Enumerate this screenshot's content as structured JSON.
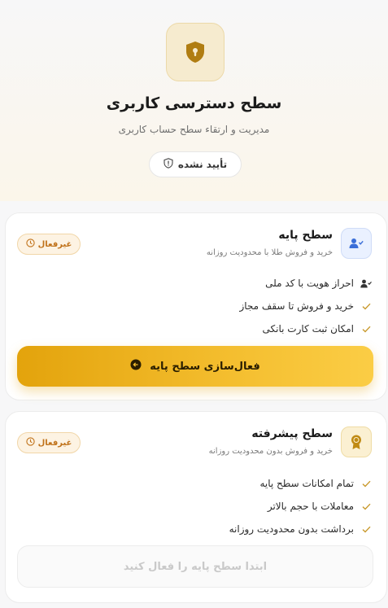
{
  "hero": {
    "icon": "shield-lock-icon",
    "title": "سطح دسترسی کاربری",
    "subtitle": "مدیریت و ارتقاء سطح حساب کاربری",
    "status_label": "تأیید نشده",
    "status_icon": "shield-alert-icon"
  },
  "levels": [
    {
      "icon": "user-check-icon",
      "title": "سطح پایه",
      "description": "خرید و فروش طلا با محدودیت روزانه",
      "badge": "غیرفعال",
      "badge_icon": "clock-icon",
      "features": [
        {
          "icon": "user-check-icon",
          "label": "احراز هویت با کد ملی"
        },
        {
          "icon": "check-icon",
          "label": "خرید و فروش تا سقف مجاز"
        },
        {
          "icon": "check-icon",
          "label": "امکان ثبت کارت بانکی"
        }
      ],
      "action_label": "فعال‌سازی سطح پایه",
      "action_icon": "arrow-left-circle-icon"
    },
    {
      "icon": "award-medal-icon",
      "title": "سطح پیشرفته",
      "description": "خرید و فروش بدون محدودیت روزانه",
      "badge": "غیرفعال",
      "badge_icon": "clock-icon",
      "features": [
        {
          "icon": "check-icon",
          "label": "تمام امکانات سطح پایه"
        },
        {
          "icon": "check-icon",
          "label": "معاملات با حجم بالاتر"
        },
        {
          "icon": "check-icon",
          "label": "برداشت بدون محدودیت روزانه"
        }
      ],
      "action_label": "ابتدا سطح پایه را فعال کنید"
    }
  ],
  "colors": {
    "accent_gold": "#e3a30c",
    "badge_text": "#c0721a",
    "check_gold": "#c99a2e",
    "user_blue": "#3b6fd8"
  }
}
